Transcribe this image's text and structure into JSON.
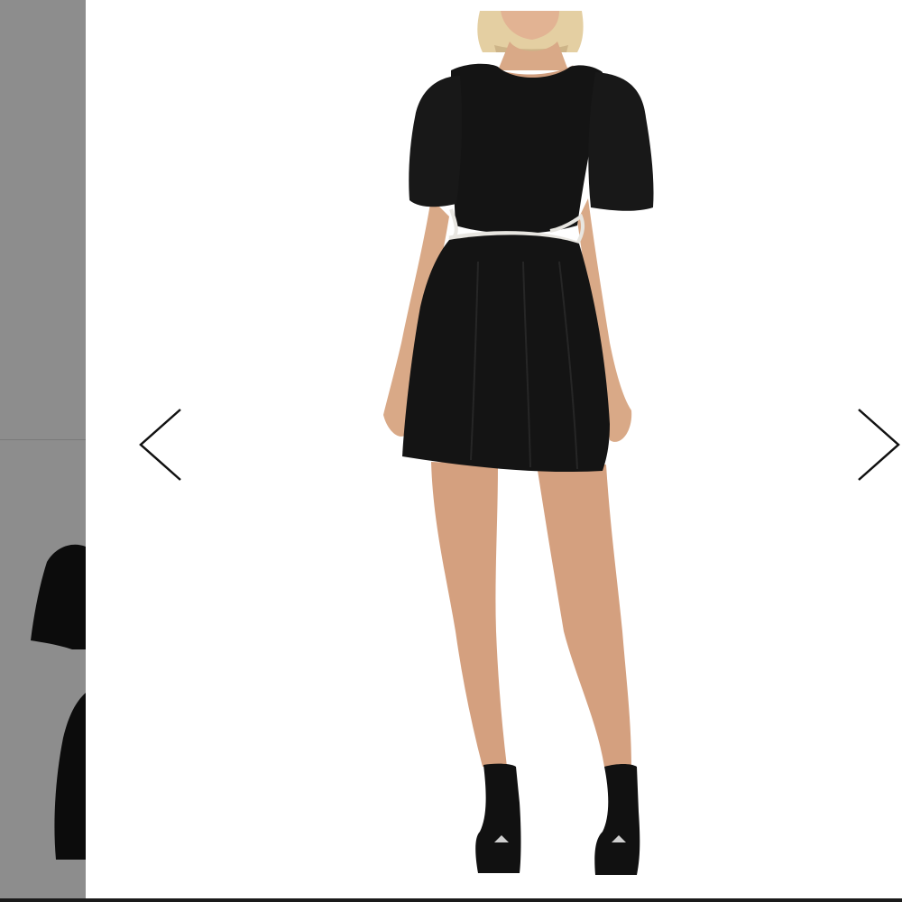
{
  "gallery": {
    "thumbnails": [
      {
        "label": "",
        "icon": "dress-front-thumbnail"
      },
      {
        "label": "",
        "icon": "dress-back-thumbnail"
      }
    ],
    "main_image": {
      "icon": "model-in-black-cutout-mini-dress"
    },
    "prev_icon": "chevron-left-icon",
    "next_icon": "chevron-right-icon"
  },
  "colors": {
    "background": "#ffffff",
    "thumbnail_overlay": "#8d8d8d",
    "dress": "#141414",
    "trim": "#e8e6e1",
    "skin": "#d9a987",
    "hair": "#e4cfa2"
  }
}
